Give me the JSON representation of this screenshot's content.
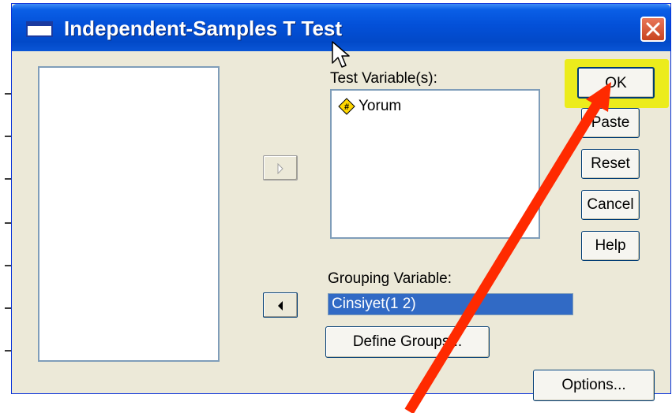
{
  "window": {
    "title": "Independent-Samples T Test"
  },
  "icons": {
    "window": "window-icon",
    "close": "close-icon",
    "move_right": "arrow-right-icon",
    "move_left": "arrow-left-icon",
    "scale_variable": "scale-variable-icon",
    "cursor": "mouse-cursor-icon"
  },
  "labels": {
    "test_variables": "Test Variable(s):",
    "grouping_variable": "Grouping Variable:"
  },
  "test_variables": [
    {
      "name": "Yorum"
    }
  ],
  "grouping_variable": {
    "value": "Cinsiyet(1 2)"
  },
  "buttons": {
    "ok": "OK",
    "paste": "Paste",
    "reset": "Reset",
    "cancel": "Cancel",
    "help": "Help",
    "define_groups": "Define Groups...",
    "options": "Options..."
  },
  "colors": {
    "highlight": "#ecec1c",
    "annotation_arrow": "#ff2a00",
    "selection": "#316ac5"
  }
}
